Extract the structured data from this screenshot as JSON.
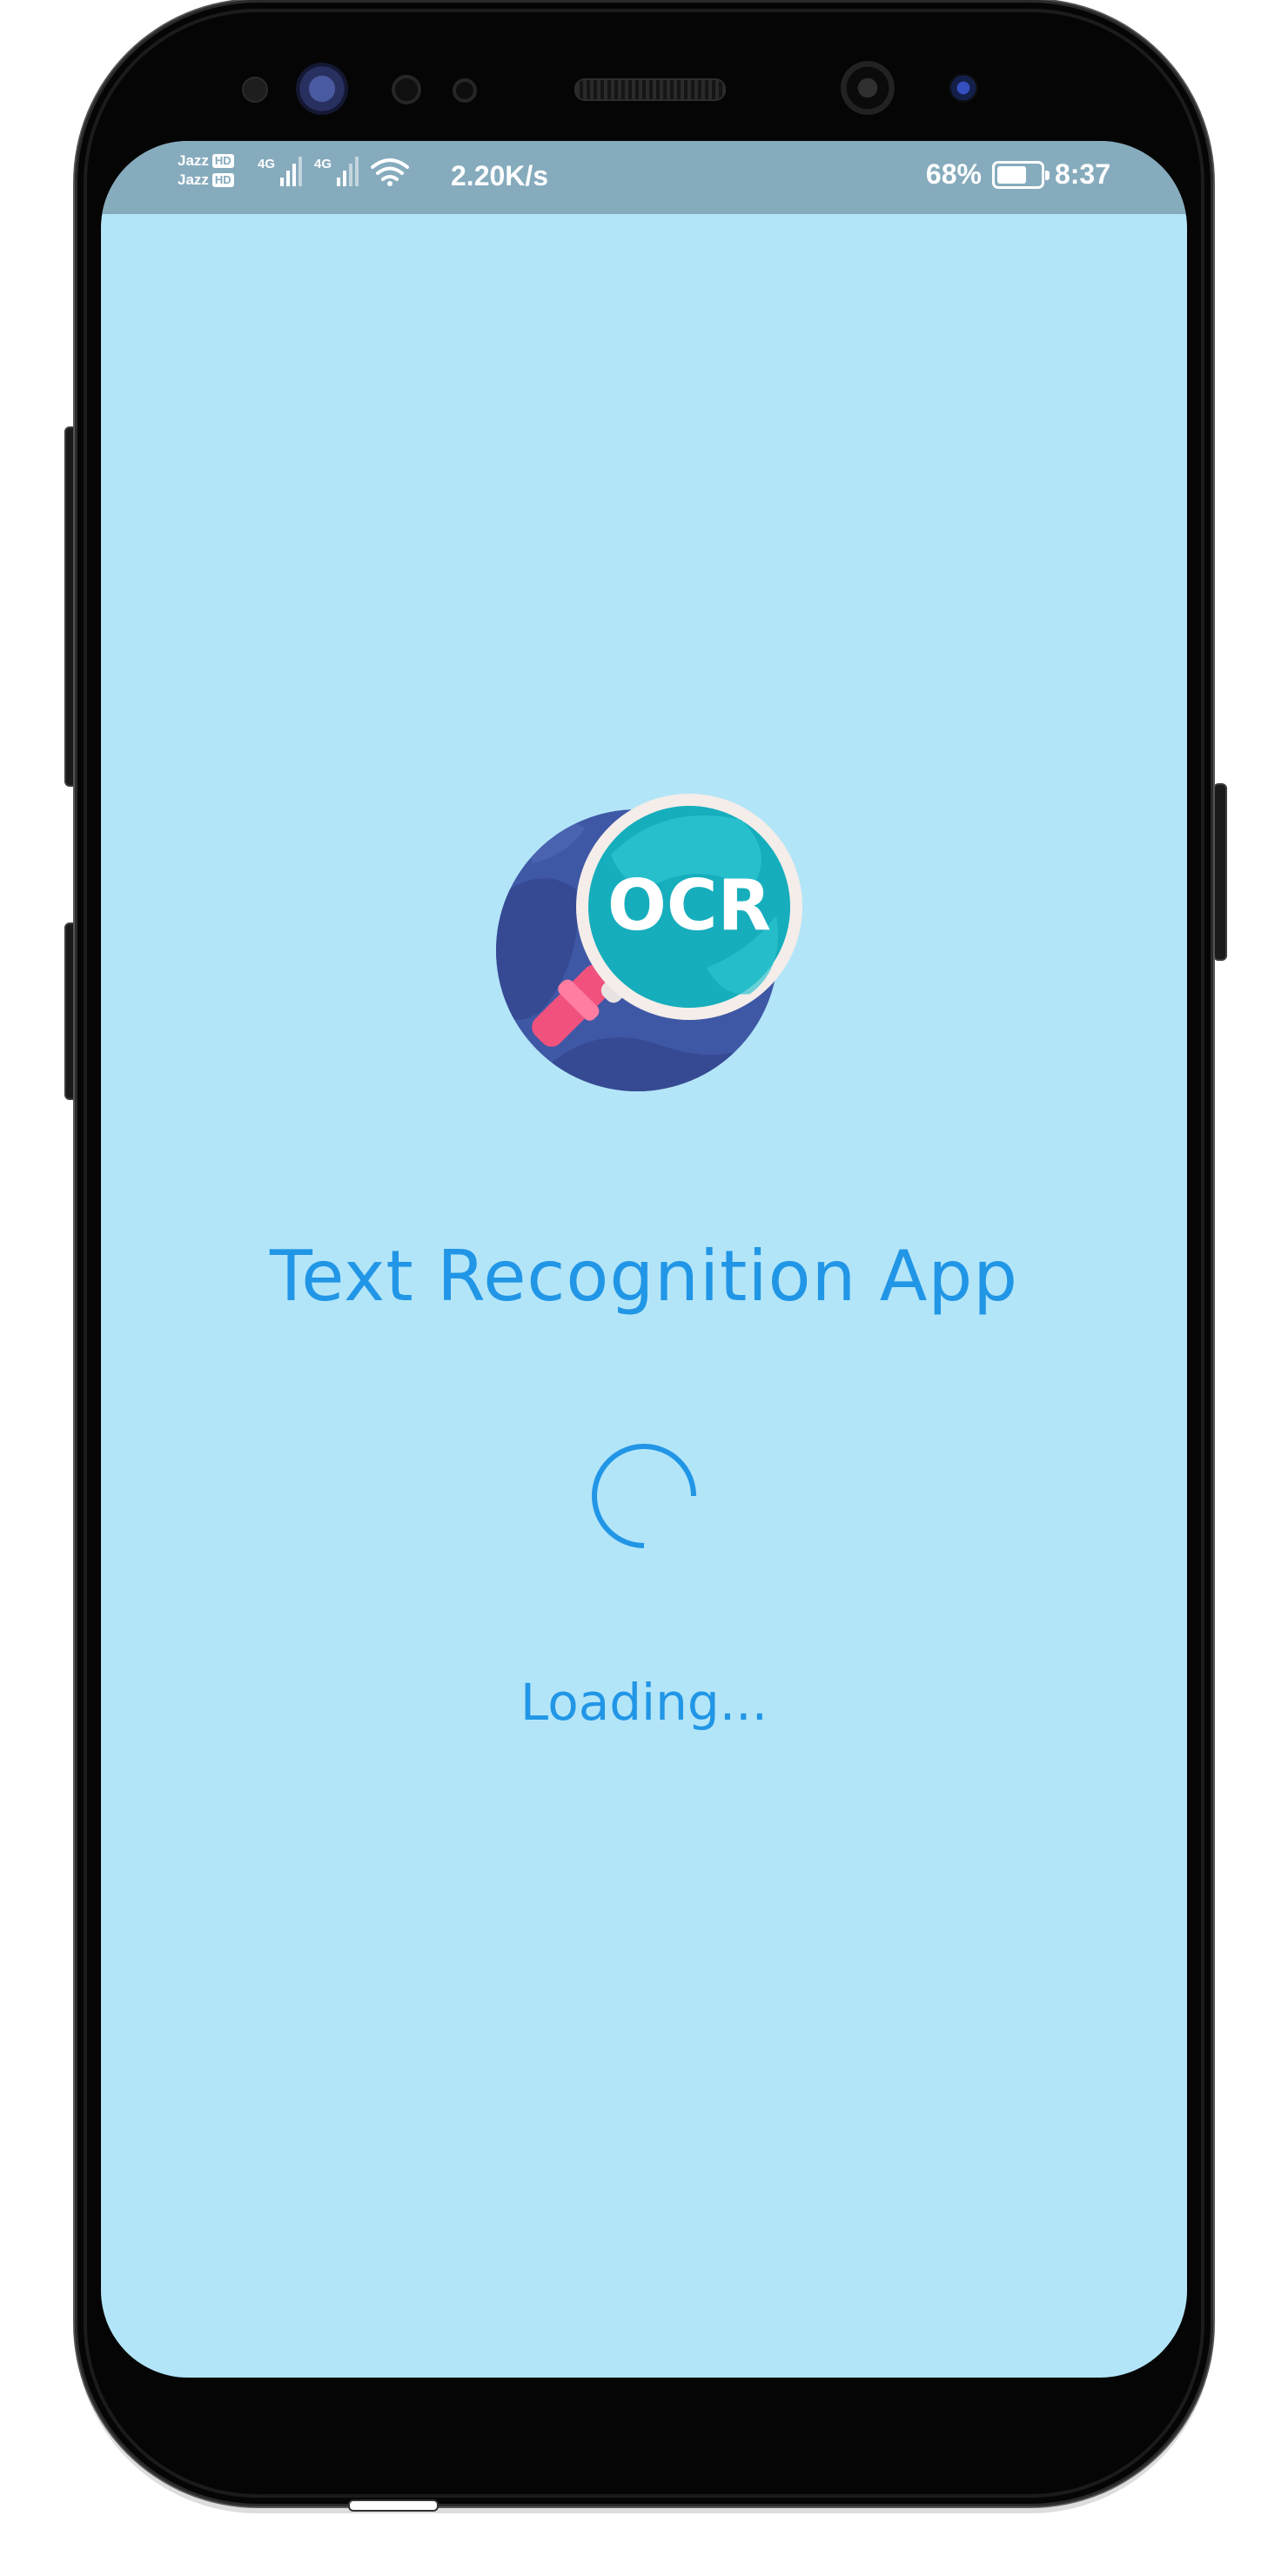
{
  "status_bar": {
    "carrier_1": "Jazz",
    "carrier_2": "Jazz",
    "hd_badge": "HD",
    "net_type_1": "4G",
    "net_type_2": "4G",
    "net_speed": "2.20K/s",
    "battery_percent": "68%",
    "battery_level": 0.68,
    "time": "8:37"
  },
  "app": {
    "logo_text": "OCR",
    "title": "Text Recognition App",
    "loading_text": "Loading...",
    "colors": {
      "background": "#b3e5f8",
      "status_bar": "#86abbd",
      "accent": "#2196e6"
    }
  }
}
